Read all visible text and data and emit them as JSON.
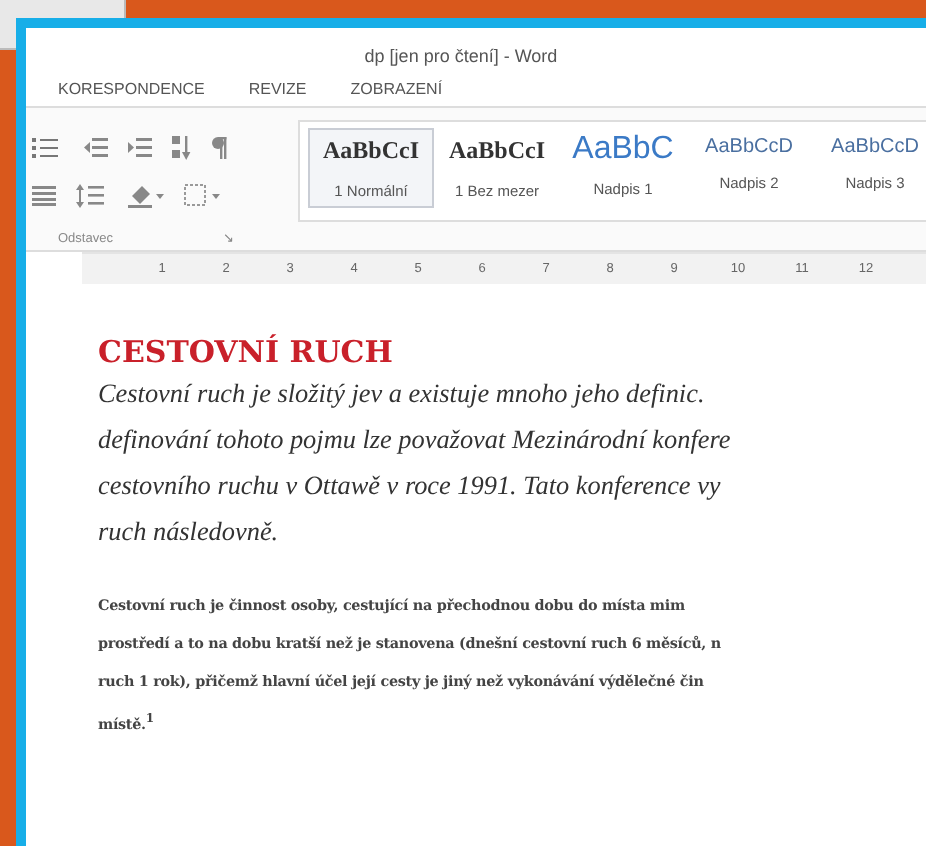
{
  "window": {
    "title": "dp [jen pro čtení] - Word"
  },
  "tabs": [
    "KORESPONDENCE",
    "REVIZE",
    "ZOBRAZENÍ"
  ],
  "styles": [
    {
      "sample": "AaBbCcI",
      "label": "1 Normální",
      "kind": "normal",
      "selected": true
    },
    {
      "sample": "AaBbCcI",
      "label": "1 Bez mezer",
      "kind": "normal",
      "selected": false
    },
    {
      "sample": "AaBbC",
      "label": "Nadpis 1",
      "kind": "heading1",
      "selected": false
    },
    {
      "sample": "AaBbCcD",
      "label": "Nadpis 2",
      "kind": "heading2",
      "selected": false
    },
    {
      "sample": "AaBbCcD",
      "label": "Nadpis 3",
      "kind": "heading2",
      "selected": false
    }
  ],
  "ribbon_group": {
    "label": "Odstavec",
    "launcher": "↘"
  },
  "ruler": [
    "1",
    "2",
    "3",
    "4",
    "5",
    "6",
    "7",
    "8",
    "9",
    "10",
    "11",
    "12"
  ],
  "document": {
    "heading": "CESTOVNÍ RUCH",
    "intro_lines": [
      "Cestovní ruch je složitý jev a existuje mnoho jeho definic.",
      "definování tohoto pojmu lze považovat Mezinárodní konfere",
      "cestovního ruchu v Ottawě v roce 1991. Tato konference vy",
      "ruch následovně."
    ],
    "definition_lines": [
      "Cestovní ruch je činnost osoby, cestující na přechodnou dobu do místa mim",
      "prostředí a to na dobu kratší než je stanovena (dnešní cestovní ruch 6 měsíců, n",
      "ruch 1 rok), přičemž hlavní účel její cesty je jiný než vykonávání výdělečné čin",
      "místě.$^{1}$"
    ]
  }
}
